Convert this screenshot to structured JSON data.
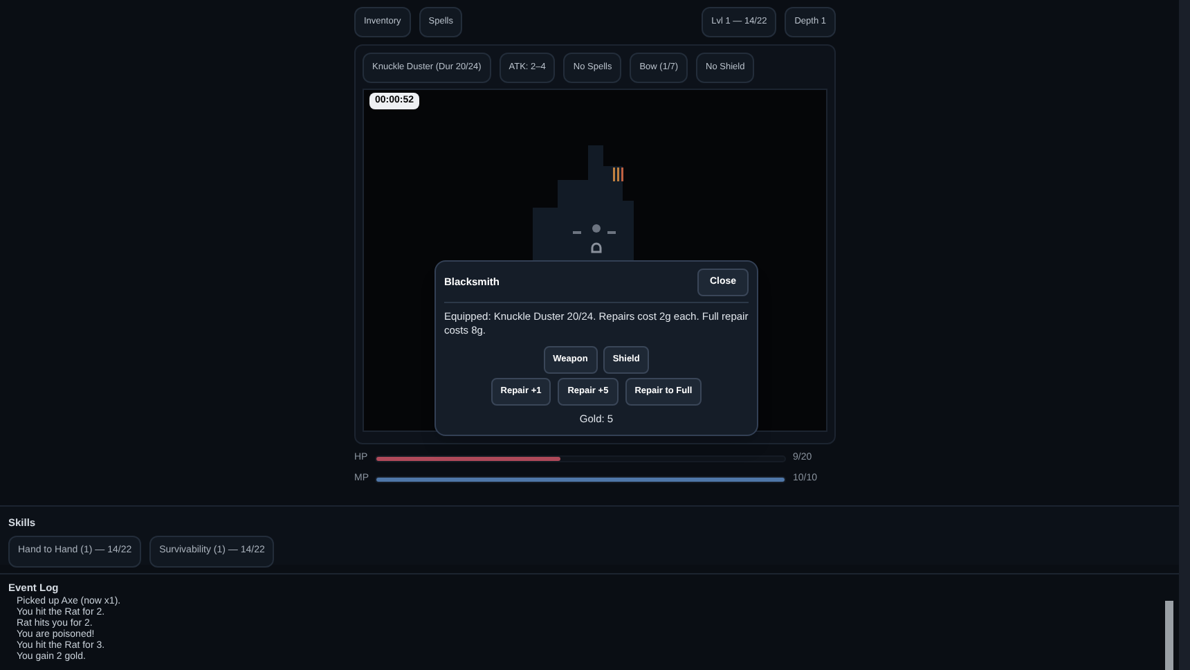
{
  "top_bar": {
    "tabs": [
      {
        "label": "Inventory"
      },
      {
        "label": "Spells"
      }
    ],
    "badges": [
      "Lvl 1 — 14/22",
      "Depth 1"
    ]
  },
  "equipment": [
    "Knuckle Duster (Dur 20/24)",
    "ATK: 2–4",
    "No Spells",
    "Bow (1/7)",
    "No Shield"
  ],
  "game": {
    "timer": "00:00:52"
  },
  "dialog": {
    "title": "Blacksmith",
    "close": "Close",
    "message": "Equipped: Knuckle Duster 20/24. Repairs cost 2g each. Full repair costs 8g.",
    "targets": [
      {
        "label": "Weapon"
      },
      {
        "label": "Shield"
      }
    ],
    "actions": [
      "Repair +1",
      "Repair +5",
      "Repair to Full"
    ],
    "gold": "Gold: 5"
  },
  "stats": [
    {
      "label": "HP",
      "level": 0.45,
      "reading": "9/20",
      "color": "#b04a5a"
    },
    {
      "label": "MP",
      "level": 1.0,
      "reading": "10/10",
      "color": "#4f77a8"
    }
  ],
  "skills": {
    "title": "Skills",
    "items": [
      "Hand to Hand (1) — 14/22",
      "Survivability (1) — 14/22"
    ]
  },
  "event_log": {
    "title": "Event Log",
    "entries": [
      "Picked up Axe (now x1).",
      "You hit the Rat for 2.",
      "Rat hits you for 2.",
      "You are poisoned!",
      "You hit the Rat for 3.",
      "You gain 2 gold."
    ]
  }
}
